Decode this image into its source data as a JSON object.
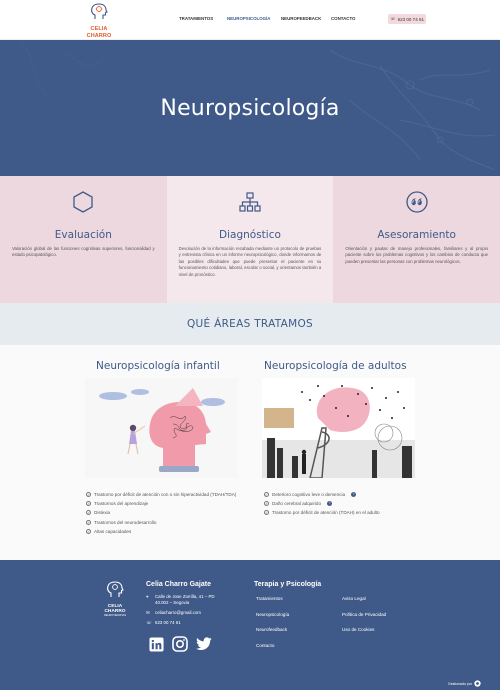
{
  "header": {
    "logo_name": "CELIA CHARRO",
    "logo_sub": "NEUROTERAPIAS",
    "nav": [
      "TRATAMIENTOS",
      "NEUROPSICOLOGÍA",
      "NEUROFEEDBACK",
      "CONTACTO"
    ],
    "active_nav": "NEUROPSICOLOGÍA",
    "phone": "623 00 74 61",
    "accent": "#3d5a8a"
  },
  "hero": {
    "title": "Neuropsicología",
    "bg": "#3f5a89"
  },
  "services": [
    {
      "icon": "hexagon-icon",
      "title": "Evaluación",
      "text": "Valoración global de las funciones cognitivas superiores, funcionalidad y estado psicopatológico."
    },
    {
      "icon": "network-icon",
      "title": "Diagnóstico",
      "text": "Devolución de la información recabada mediante un protocolo de pruebas y entrevista clínica en un informe neuropsicológico, donde informamos de las posibles dificultades que puede presentar el paciente en su funcionamiento cotidiano, laboral, escolar o social, y orientamos también a nivel de pronóstico."
    },
    {
      "icon": "quote-icon",
      "title": "Asesoramiento",
      "text": "Orientación y pautas de manejo profesionales, familiares y al propio paciente sobre los problemas cognitivos y los cambios de conducta que pueden presentar las personas con problemas neurológicos."
    }
  ],
  "areas": {
    "title": "QUÉ ÁREAS TRATAMOS",
    "infantil": {
      "title": "Neuropsicología infantil",
      "items": [
        "Trastorno por déficit de atención con o sin hiperactividad (TDAH/TDA)",
        "Trastornos del aprendizaje",
        "Dislexia",
        "Trastornos del neurodesarrollo",
        "Altas capacidades"
      ]
    },
    "adultos": {
      "title": "Neuropsicología de adultos",
      "items": [
        "Deterioro cognitivo leve o demencia",
        "Daño cerebral adquirido",
        "Trastorno por déficit de atención (TDAH) en el adulto"
      ]
    }
  },
  "footer": {
    "name": "Celia Charro Gajate",
    "address": "Calle de Jose Zorrilla, 41 – PD",
    "address2": "40.002 – Segovia",
    "email": "celiacharro@gmail.com",
    "phone": "623 00 74 61",
    "section_title": "Terapia y Psicología",
    "links_col1": [
      "Tratamientos",
      "Neuropsicología",
      "Neurofeedback",
      "Contacto"
    ],
    "links_col2": [
      "Aviso Legal",
      "Política de Privacidad",
      "Uso de Cookies"
    ],
    "logo_name": "CELIA CHARRO",
    "logo_sub": "NEUROTERAPIAS",
    "badge": "Gestionado por"
  }
}
